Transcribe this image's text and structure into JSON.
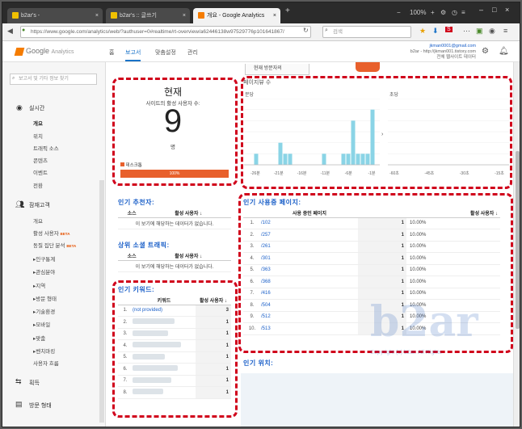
{
  "browser": {
    "tabs": [
      {
        "title": "b2ar's -"
      },
      {
        "title": "b2ar's :: 글쓰기"
      },
      {
        "title": "개요 - Google Analytics"
      }
    ],
    "new_tab": "+",
    "url": "https://www.google.com/analytics/web/?authuser=0#realtime/rt-overview/a62446138w97529776p101641867/",
    "search_placeholder": "검색",
    "zoom": "100%"
  },
  "ga": {
    "logo": "Google",
    "logo_sub": "Analytics",
    "nav": [
      {
        "label": "홈"
      },
      {
        "label": "보고서"
      },
      {
        "label": "맞춤설정"
      },
      {
        "label": "관리"
      }
    ],
    "account_email": "jkman0001@gmail.com",
    "account_site": "b2ar - http://jkman001.tistory.com",
    "account_view": "전체 웹사이트 데이터"
  },
  "sidebar": {
    "search_placeholder": "보고서 및 기타 정보 찾기",
    "realtime": {
      "title": "실시간",
      "items": [
        "개요",
        "위치",
        "트래픽 소스",
        "콘텐츠",
        "이벤트",
        "전환"
      ]
    },
    "audience": {
      "title": "잠재고객",
      "items": [
        "개요",
        "활성 사용자",
        "동질 집단 분석",
        "▸인구통계",
        "▸관심분야",
        "▸지역",
        "▸방문 형태",
        "▸기술환경",
        "▸모바일",
        "▸맞춤",
        "▸벤치마킹",
        "사용자 흐름"
      ],
      "beta": "BETA"
    },
    "acquisition": {
      "title": "획득"
    },
    "behavior": {
      "title": "방문 형태"
    }
  },
  "realtime": {
    "visitor_tab": "현재 방문자의",
    "now_title": "현재",
    "now_subtitle": "사이트의 활성 사용자 수:",
    "active_users": "9",
    "unit": "명",
    "device_label": "데스크톱",
    "device_percent": "100%",
    "device_fraction": 1.0,
    "pageviews_title": "페이지뷰 수",
    "per_minute": "분당",
    "per_second": "초당",
    "minute_ticks": [
      "-26분",
      "-21분",
      "-16분",
      "-11분",
      "-6분",
      "-1분"
    ],
    "second_ticks": [
      "-60초",
      "-45초",
      "-30초",
      "-15초"
    ],
    "minute_bars": [
      0,
      0,
      1,
      0,
      0,
      0,
      0,
      2,
      1,
      1,
      0,
      0,
      0,
      0,
      0,
      0,
      1,
      0,
      0,
      0,
      1,
      1,
      4,
      1,
      1,
      1,
      5,
      0
    ],
    "minute_ymax": 6
  },
  "referrals": {
    "title": "인기 추천자:",
    "col_source": "소스",
    "col_active": "활성 사용자",
    "empty": "이 보기에 해당하는 데이터가 없습니다."
  },
  "social": {
    "title": "상위 소셜 트래픽:",
    "col_source": "소스",
    "col_active": "활성 사용자",
    "empty": "이 보기에 해당하는 데이터가 없습니다."
  },
  "keywords": {
    "title": "인기 키워드:",
    "col_keyword": "키워드",
    "col_active": "활성 사용자",
    "rows": [
      {
        "n": "1.",
        "kw": "(not provided)",
        "v": "3"
      },
      {
        "n": "2.",
        "kw": "",
        "v": "1"
      },
      {
        "n": "3.",
        "kw": "",
        "v": "1"
      },
      {
        "n": "4.",
        "kw": "",
        "v": "1"
      },
      {
        "n": "5.",
        "kw": "",
        "v": "1"
      },
      {
        "n": "6.",
        "kw": "",
        "v": "1"
      },
      {
        "n": "7.",
        "kw": "",
        "v": "1"
      },
      {
        "n": "8.",
        "kw": "",
        "v": "1"
      }
    ]
  },
  "pages": {
    "title": "인기 사용중 페이지:",
    "col_page": "사용 중인 페이지",
    "col_active": "활성 사용자",
    "rows": [
      {
        "n": "1.",
        "p": "/102",
        "v": "1",
        "pct": "10.00%"
      },
      {
        "n": "2.",
        "p": "/257",
        "v": "1",
        "pct": "10.00%"
      },
      {
        "n": "3.",
        "p": "/261",
        "v": "1",
        "pct": "10.00%"
      },
      {
        "n": "4.",
        "p": "/301",
        "v": "1",
        "pct": "10.00%"
      },
      {
        "n": "5.",
        "p": "/363",
        "v": "1",
        "pct": "10.00%"
      },
      {
        "n": "6.",
        "p": "/368",
        "v": "1",
        "pct": "10.00%"
      },
      {
        "n": "7.",
        "p": "/416",
        "v": "1",
        "pct": "10.00%"
      },
      {
        "n": "8.",
        "p": "/504",
        "v": "1",
        "pct": "10.00%"
      },
      {
        "n": "9.",
        "p": "/512",
        "v": "1",
        "pct": "10.00%"
      },
      {
        "n": "10.",
        "p": "/513",
        "v": "1",
        "pct": "10.00%"
      }
    ]
  },
  "locations": {
    "title": "인기 위치:"
  },
  "watermark": {
    "text": "b2ar",
    "sub": "Copyright (c) b2ar. All Rights"
  },
  "colors": {
    "accent": "#1a73c8",
    "bar": "#8ad4e6",
    "device": "#e8602c",
    "annot": "#d0021b"
  }
}
